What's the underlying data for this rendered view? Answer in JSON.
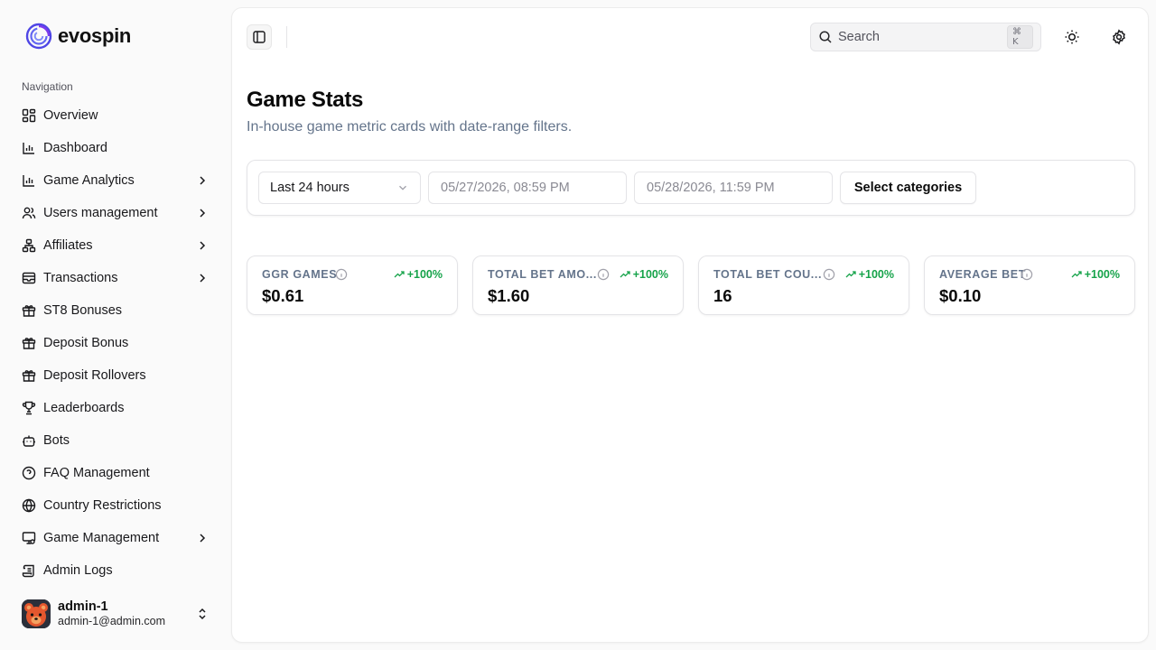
{
  "brand": {
    "name": "evospin",
    "logo_icon": "swirl-logo-icon",
    "accent": "#4f46e5"
  },
  "nav": {
    "group_label": "Navigation",
    "items": [
      {
        "label": "Overview",
        "icon": "grid-icon",
        "has_submenu": false
      },
      {
        "label": "Dashboard",
        "icon": "bar-chart-icon",
        "has_submenu": false
      },
      {
        "label": "Game Analytics",
        "icon": "bar-chart-icon",
        "has_submenu": true
      },
      {
        "label": "Users management",
        "icon": "users-icon",
        "has_submenu": true
      },
      {
        "label": "Affiliates",
        "icon": "network-icon",
        "has_submenu": true
      },
      {
        "label": "Transactions",
        "icon": "wallet-icon",
        "has_submenu": true
      },
      {
        "label": "ST8 Bonuses",
        "icon": "gift-icon",
        "has_submenu": false
      },
      {
        "label": "Deposit Bonus",
        "icon": "gift-icon",
        "has_submenu": false
      },
      {
        "label": "Deposit Rollovers",
        "icon": "gift-icon",
        "has_submenu": false
      },
      {
        "label": "Leaderboards",
        "icon": "trophy-icon",
        "has_submenu": false
      },
      {
        "label": "Bots",
        "icon": "bot-icon",
        "has_submenu": false
      },
      {
        "label": "FAQ Management",
        "icon": "help-circle-icon",
        "has_submenu": false
      },
      {
        "label": "Country Restrictions",
        "icon": "globe-icon",
        "has_submenu": false
      },
      {
        "label": "Game Management",
        "icon": "monitor-icon",
        "has_submenu": true
      },
      {
        "label": "Admin Logs",
        "icon": "scroll-icon",
        "has_submenu": false
      }
    ]
  },
  "user": {
    "name": "admin-1",
    "email": "admin-1@admin.com",
    "avatar_icon": "bear-avatar"
  },
  "topbar": {
    "search_placeholder": "Search",
    "search_shortcut": "⌘ K"
  },
  "page": {
    "title": "Game Stats",
    "subtitle": "In-house game metric cards with date-range filters."
  },
  "filters": {
    "range_value": "Last 24 hours",
    "start_placeholder": "05/27/2026, 08:59 PM",
    "end_placeholder": "05/28/2026, 11:59 PM",
    "categories_label": "Select categories"
  },
  "metrics": [
    {
      "label": "GGR GAMES",
      "value": "$0.61",
      "trend": "+100%"
    },
    {
      "label": "TOTAL BET AMO...",
      "value": "$1.60",
      "trend": "+100%"
    },
    {
      "label": "TOTAL BET COU...",
      "value": "16",
      "trend": "+100%"
    },
    {
      "label": "AVERAGE BET",
      "value": "$0.10",
      "trend": "+100%"
    }
  ],
  "colors": {
    "trend_up": "#16a34a",
    "muted": "#64748b"
  }
}
